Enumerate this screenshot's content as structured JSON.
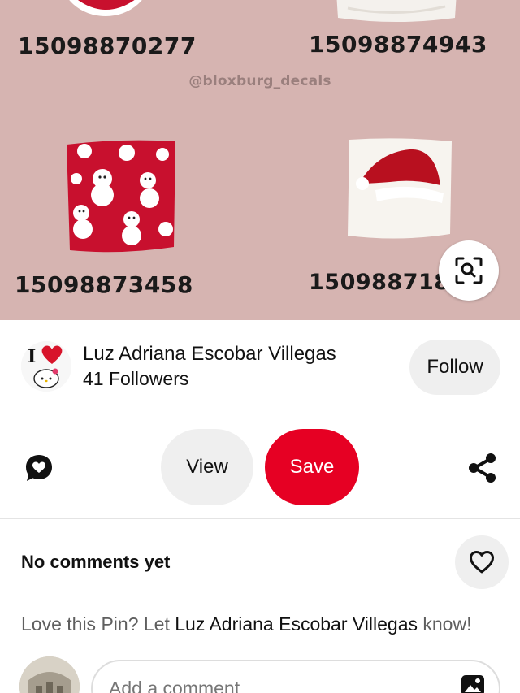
{
  "pin": {
    "image": {
      "watermark": "@bloxburg_decals",
      "codes": [
        "15098870277",
        "15098874943",
        "15098873458",
        "15098871874"
      ],
      "background_color": "#d6b4b1"
    },
    "lens_icon": "visual-search-icon"
  },
  "creator": {
    "name": "Luz Adriana Escobar Villegas",
    "followers": "41 Followers",
    "follow_label": "Follow"
  },
  "actions": {
    "comment_icon": "comment-bubble-icon",
    "view_label": "View",
    "save_label": "Save",
    "share_icon": "share-icon",
    "save_color": "#e60023"
  },
  "comments": {
    "title": "No comments yet",
    "like_icon": "heart-icon",
    "prompt_prefix": "Love this Pin? Let ",
    "prompt_name": "Luz Adriana Escobar Villegas",
    "prompt_suffix": " know!",
    "input_placeholder": "Add a comment",
    "photo_icon": "image-icon"
  }
}
